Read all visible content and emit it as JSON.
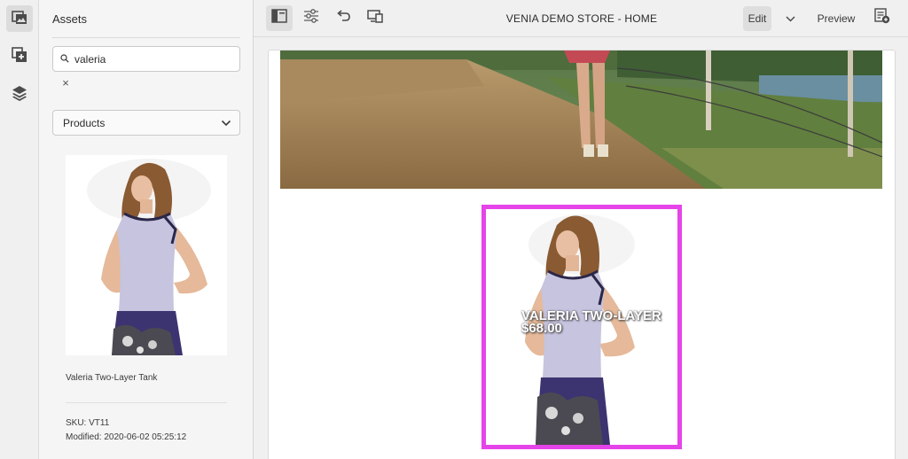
{
  "rail": {
    "items": [
      "assets-icon",
      "components-icon",
      "layers-icon"
    ]
  },
  "panel": {
    "title": "Assets",
    "search": {
      "value": "valeria",
      "placeholder": ""
    },
    "clear_symbol": "×",
    "filter": {
      "selected": "Products"
    },
    "asset": {
      "name": "Valeria Two-Layer Tank",
      "sku": "SKU: VT11",
      "modified": "Modified: 2020-06-02 05:25:12"
    }
  },
  "toolbar": {
    "page_title": "VENIA DEMO STORE - HOME",
    "edit_label": "Edit",
    "preview_label": "Preview"
  },
  "canvas": {
    "product": {
      "title": "VALERIA TWO-LAYER",
      "price": "$68.00"
    }
  },
  "colors": {
    "highlight": "#e544e8",
    "background": "#f0f0f0"
  }
}
